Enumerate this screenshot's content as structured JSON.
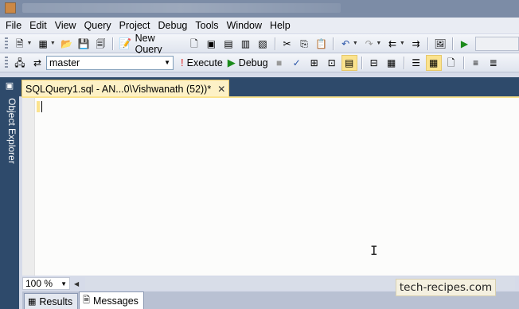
{
  "menu": [
    "File",
    "Edit",
    "View",
    "Query",
    "Project",
    "Debug",
    "Tools",
    "Window",
    "Help"
  ],
  "toolbar1": {
    "new_query_label": "New Query"
  },
  "toolbar2": {
    "database": "master",
    "execute_label": "Execute",
    "debug_label": "Debug"
  },
  "object_explorer_label": "Object Explorer",
  "document_tab": {
    "title": "SQLQuery1.sql - AN...0\\Vishwanath (52))*",
    "close_glyph": "✕"
  },
  "zoom": "100 %",
  "result_tabs": [
    {
      "label": "Results",
      "active": false
    },
    {
      "label": "Messages",
      "active": true
    }
  ],
  "watermark": "tech-recipes.com"
}
